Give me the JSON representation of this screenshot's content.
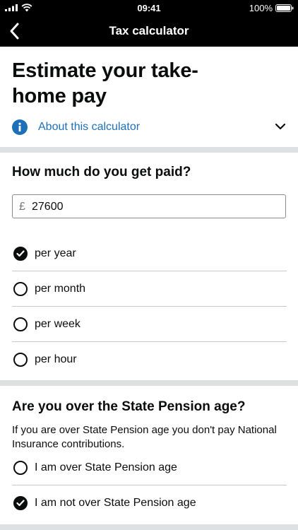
{
  "status_bar": {
    "time": "09:41",
    "battery": "100%"
  },
  "nav": {
    "title": "Tax calculator"
  },
  "header": {
    "headline": "Estimate your take-home pay",
    "about_label": "About this calculator"
  },
  "pay_question": {
    "title": "How much do you get paid?",
    "currency_symbol": "£",
    "amount": "27600",
    "options": [
      {
        "label": "per year",
        "checked": true
      },
      {
        "label": "per month",
        "checked": false
      },
      {
        "label": "per week",
        "checked": false
      },
      {
        "label": "per hour",
        "checked": false
      }
    ]
  },
  "pension_question": {
    "title": "Are you over the State Pension age?",
    "hint": "If you are over State Pension age you don't pay National Insurance contributions.",
    "options": [
      {
        "label": "I am over State Pension age",
        "checked": false
      },
      {
        "label": "I am not over State Pension age",
        "checked": true
      }
    ]
  },
  "colors": {
    "link": "#1d70b8",
    "divider": "#dee0e2",
    "bar": "#000000"
  }
}
